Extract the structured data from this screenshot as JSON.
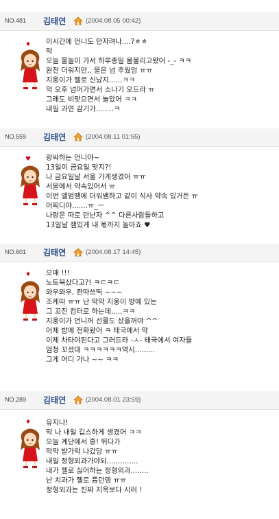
{
  "posts": [
    {
      "no": "NO.481",
      "author": "김태연",
      "date": "(2004.08.05 00:42)",
      "emoticon": "♦",
      "emoticon_color": "#c8101a",
      "lines": [
        "이시간에 언니도 안자려나....?ㅎㅎ",
        "막",
        "오늘 물놀이 가서 하루종일 몸불리고왔어 -_- ㅋㅋ",
        "완전 더워지만,, 물은 넘 추웠엉 ㅠㅠ",
        "지웅이가 젤로 신났지......ㅋㅋ",
        "막 오후 넘어가면서 소나기 오드라 ㅠ",
        "그래도 비맞으면서 놀았어 ㅋㅋ",
        "내일 과연 감기가........ㅋ"
      ]
    },
    {
      "no": "NO.559",
      "author": "김태연",
      "date": "(2004.08.11 01:55)",
      "emoticon": "♥",
      "emoticon_color": "#c8101a",
      "lines": [
        "랑싸하는 언니야~",
        "13일이 금요일 맞지?!",
        "나 금요일날 서울 가게생겼어 ㅠㅠ",
        "서울에서 약속있어서 ㅠ",
        "이번 앨범땜에 더워쌤하고 같이 식사 약속 있거든 ㅠ",
        "어찌디야.......ㅠ_ㅡ",
        "나랑은 따로 만난자 ^^ 다른사람들하고",
        "13일날 잼있게 내 몫까지 놀아죠 ♥"
      ]
    },
    {
      "no": "NO.601",
      "author": "김태연",
      "date": "(2004.08.17 14:45)",
      "emoticon": "♦",
      "emoticon_color": "#c8101a",
      "lines": [
        "오매 !!!",
        "노트북샀다고?! ㅋㄷㅋㄷ",
        "와우와우, 좐따쓰띡 ~~~",
        "조케따 ㅠㅠ 난 막막 지웅이 방에 있는",
        "그 꼬진 컴터로 하는데.....ㅋㅋ",
        "지웅이가 언니꺼 선물도 샀을꺼야 ^^",
        "어제 밤에 전화왔어 ㅋ 태국에서 막",
        "이제 차타야된다고 그러드라 -ㅅ- 태국에서 여자들",
        "엄청 꼬셨대 ㅋㅋㅋㅋㅋㅋ역시.........",
        "그게 어디 가나 ~~ ㅋㅋ"
      ]
    },
    {
      "no": "NO.289",
      "author": "김태연",
      "date": "(2004.08.01 23:59)",
      "emoticon": "♦",
      "emoticon_color": "#c8101a",
      "lines": [
        "유지나!",
        "막 나 내일 깁스하게 생겼어 ㅋㅋ",
        "오늘 계단에서 홍! 뛰다가",
        "막막 발가락 나갔당 ㅠㅠ",
        "내일 정형외과가야되..............",
        "내가 젤로 싫어하는 정형외과........",
        "난 치과가 젤로 퓽던뎅 ㅠㅠ",
        "정형외과는 진짜 지옥보다 시러 !"
      ]
    }
  ]
}
